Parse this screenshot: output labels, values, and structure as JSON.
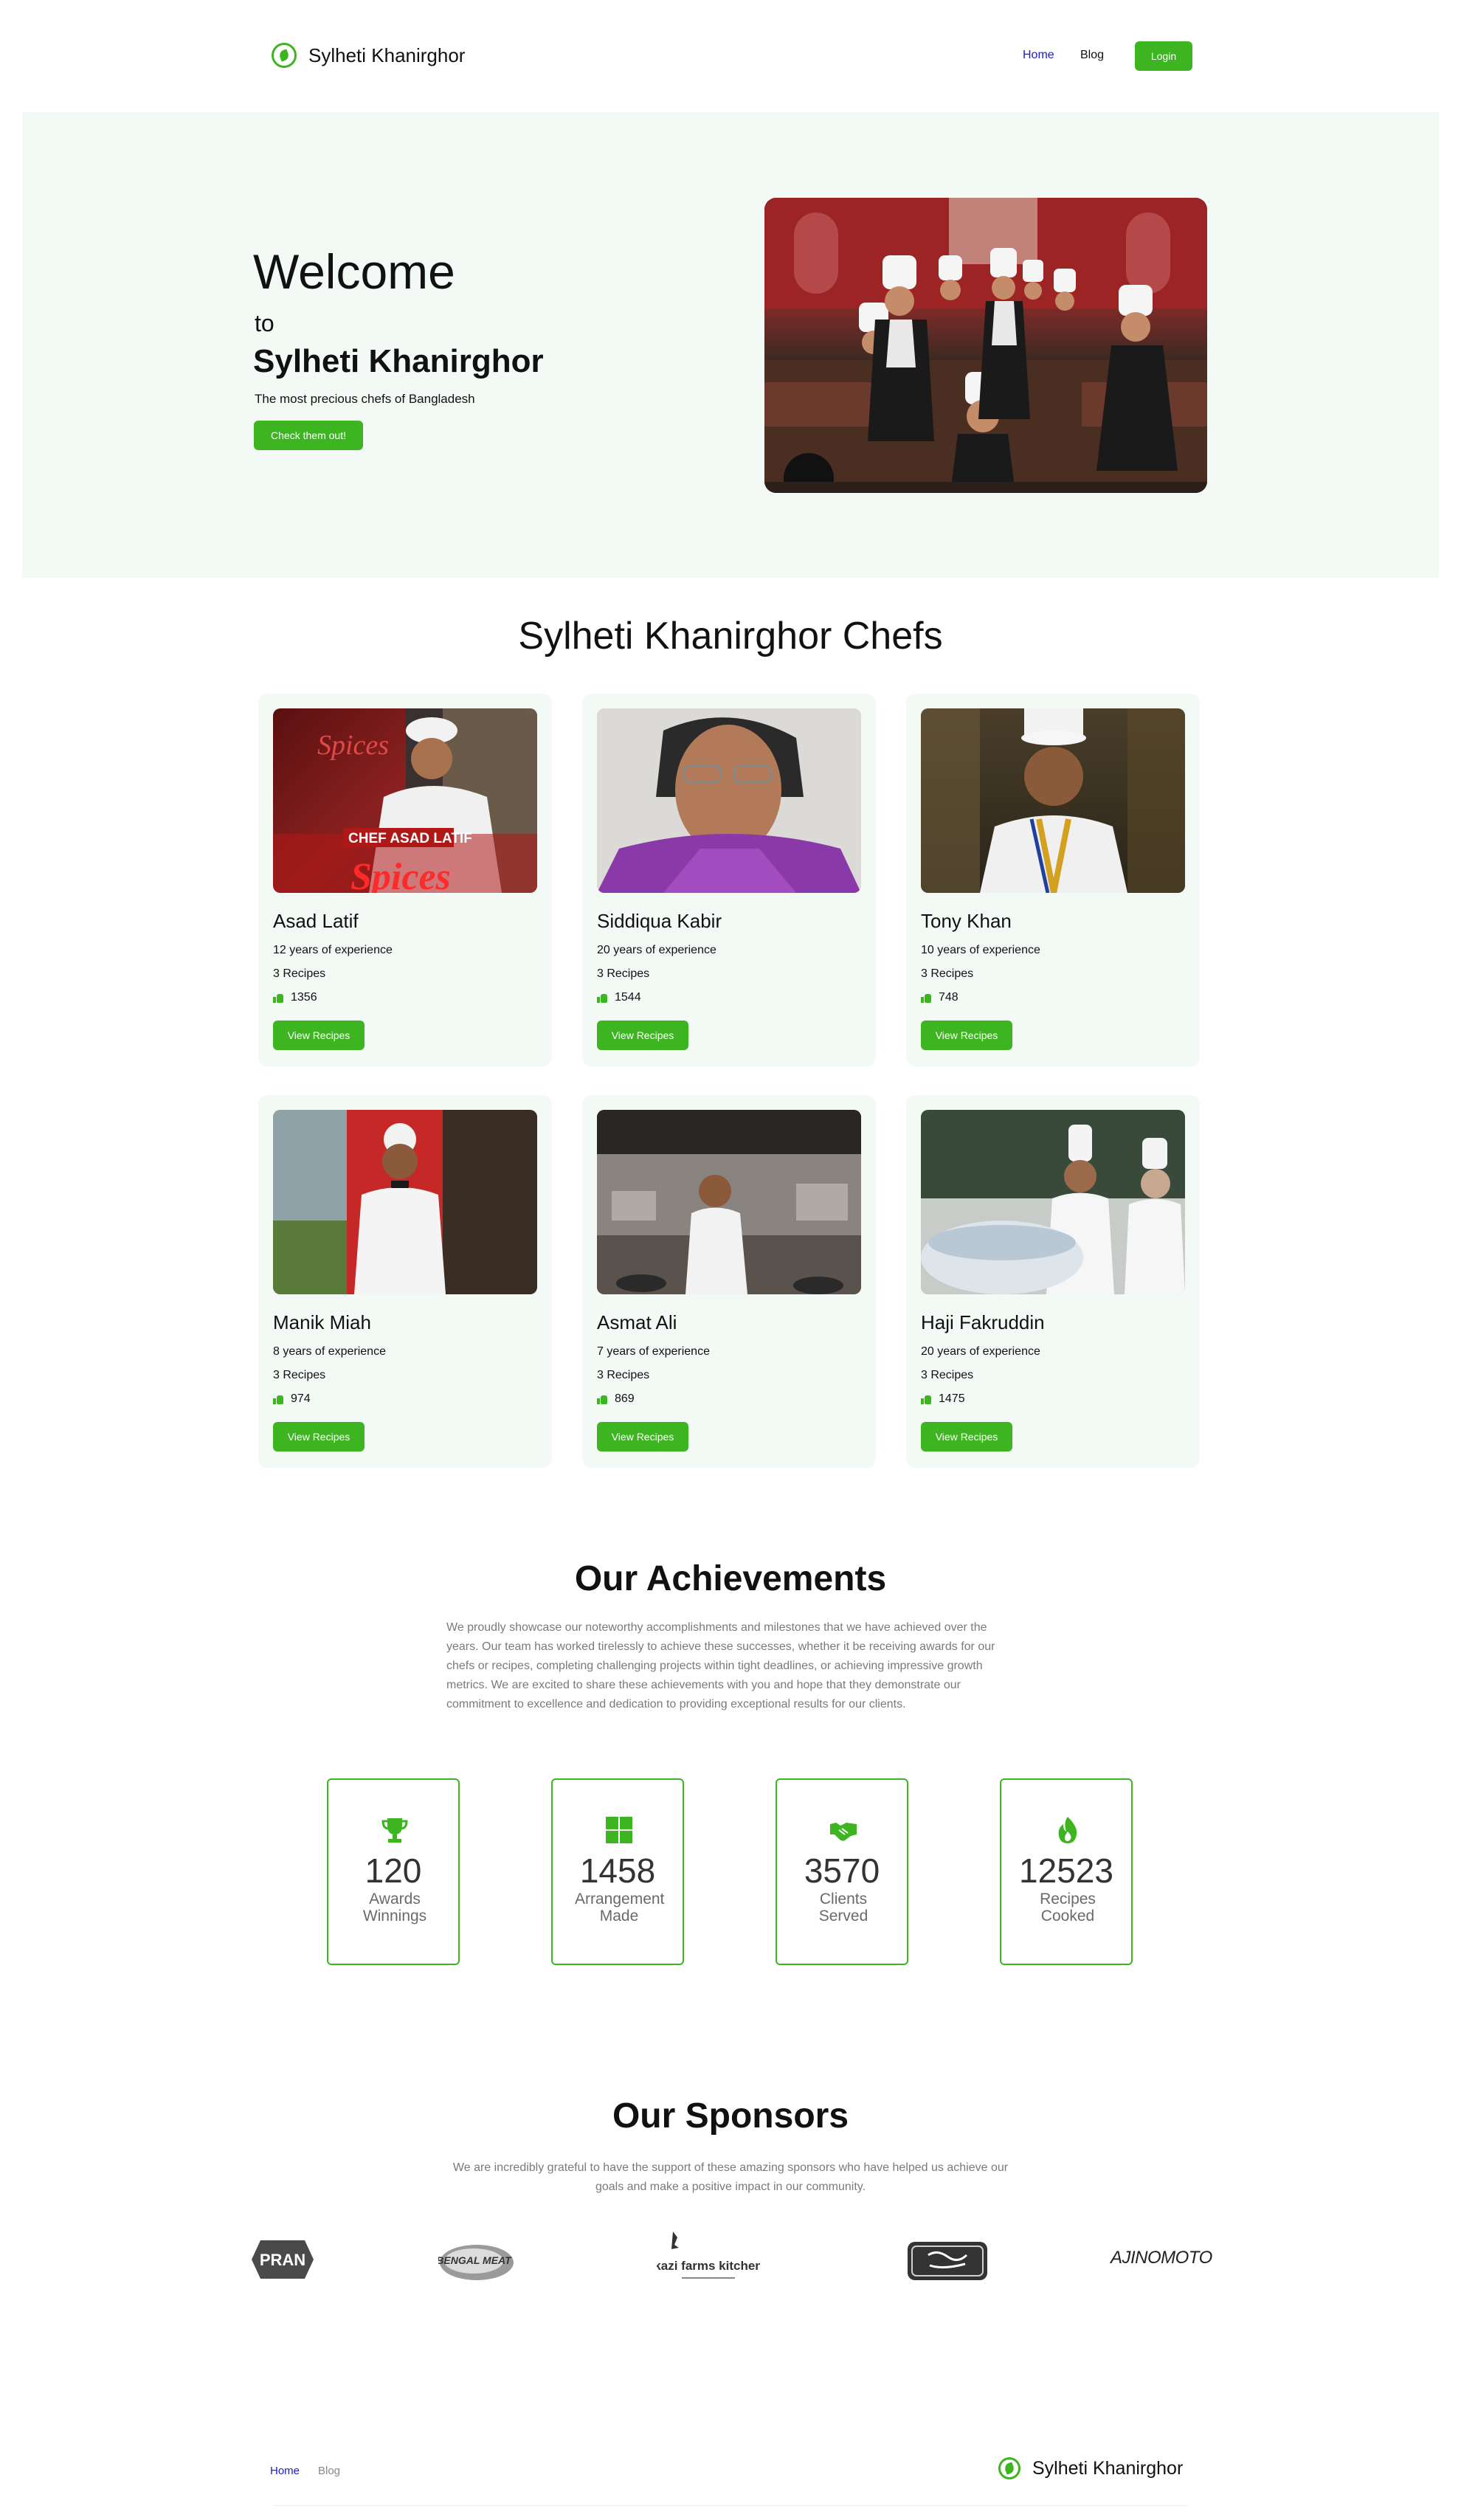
{
  "nav": {
    "brand": "Sylheti Khanirghor",
    "links": [
      "Home",
      "Blog"
    ],
    "login": "Login"
  },
  "hero": {
    "welcome": "Welcome",
    "to": "to",
    "name": "Sylheti Khanirghor",
    "tagline": "The most precious chefs of Bangladesh",
    "cta": "Check them out!"
  },
  "chefs": {
    "title": "Sylheti Khanirghor Chefs",
    "button_label": "View Recipes",
    "items": [
      {
        "name": "Asad Latif",
        "experience": "12 years of experience",
        "recipes": "3 Recipes",
        "likes": "1356",
        "banner": "CHEF ASAD LATIF",
        "banner_top": "Spices"
      },
      {
        "name": "Siddiqua Kabir",
        "experience": "20 years of experience",
        "recipes": "3 Recipes",
        "likes": "1544"
      },
      {
        "name": "Tony Khan",
        "experience": "10 years of experience",
        "recipes": "3 Recipes",
        "likes": "748"
      },
      {
        "name": "Manik Miah",
        "experience": "8 years of experience",
        "recipes": "3 Recipes",
        "likes": "974"
      },
      {
        "name": "Asmat Ali",
        "experience": "7 years of experience",
        "recipes": "3 Recipes",
        "likes": "869"
      },
      {
        "name": "Haji Fakruddin",
        "experience": "20 years of experience",
        "recipes": "3 Recipes",
        "likes": "1475"
      }
    ]
  },
  "achievements": {
    "title": "Our Achievements",
    "description": "We proudly showcase our noteworthy accomplishments and milestones that we have achieved over the years. Our team has worked tirelessly to achieve these successes, whether it be receiving awards for our chefs or recipes, completing challenging projects within tight deadlines, or achieving impressive growth metrics. We are excited to share these achievements with you and hope that they demonstrate our commitment to excellence and dedication to providing exceptional results for our clients.",
    "stats": [
      {
        "value": "120",
        "label": "Awards Winnings",
        "icon": "trophy-icon"
      },
      {
        "value": "1458",
        "label": "Arrangement Made",
        "icon": "grid-icon"
      },
      {
        "value": "3570",
        "label": "Clients Served",
        "icon": "handshake-icon"
      },
      {
        "value": "12523",
        "label": "Recipes Cooked",
        "icon": "flame-icon"
      }
    ],
    "accent": "#3cb521"
  },
  "sponsors": {
    "title": "Our Sponsors",
    "description": "We are incredibly grateful to have the support of these amazing sponsors who have helped us achieve our goals and make a positive impact in our community.",
    "logos": [
      "PRAN",
      "BENGAL MEAT",
      "kazi farms kitchen",
      "AJINOMOTO"
    ]
  },
  "footer": {
    "links": [
      "Home",
      "Blog"
    ],
    "brand": "Sylheti Khanirghor"
  }
}
